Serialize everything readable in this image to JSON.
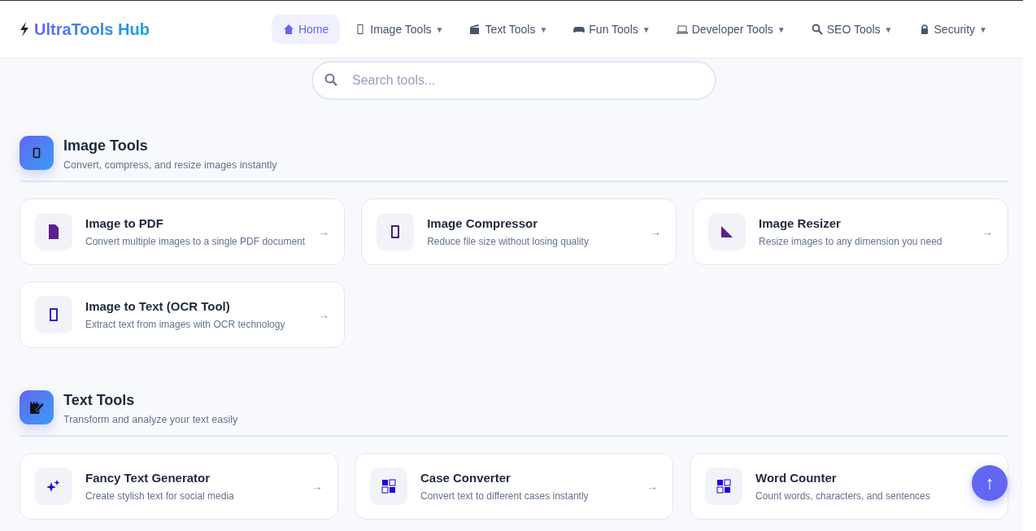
{
  "brand": {
    "name": "UltraTools Hub"
  },
  "nav": [
    {
      "label": "Home",
      "selected": true
    },
    {
      "label": "Image Tools",
      "caret": "▼",
      "selected": false
    },
    {
      "label": "Text Tools",
      "caret": "▼",
      "selected": false
    },
    {
      "label": "Fun Tools",
      "caret": "▼",
      "selected": false
    },
    {
      "label": "Developer Tools",
      "caret": "▼",
      "selected": false
    },
    {
      "label": "SEO Tools",
      "caret": "▼",
      "selected": false
    },
    {
      "label": "Security",
      "caret": "▼",
      "selected": false
    }
  ],
  "search": {
    "placeholder": "Search tools..."
  },
  "sections": [
    {
      "title": "Image Tools",
      "subtitle": "Convert, compress, and resize images instantly",
      "tools": [
        {
          "name": "Image to PDF",
          "description": "Convert multiple images to a single PDF document",
          "arrow": "→"
        },
        {
          "name": "Image Compressor",
          "description": "Reduce file size without losing quality",
          "arrow": "→"
        },
        {
          "name": "Image Resizer",
          "description": "Resize images to any dimension you need",
          "arrow": "→"
        },
        {
          "name": "Image to Text (OCR Tool)",
          "description": "Extract text from images with OCR technology",
          "arrow": "→"
        }
      ]
    },
    {
      "title": "Text Tools",
      "subtitle": "Transform and analyze your text easily",
      "tools": [
        {
          "name": "Fancy Text Generator",
          "description": "Create stylish text for social media",
          "arrow": "→"
        },
        {
          "name": "Case Converter",
          "description": "Convert text to different cases instantly",
          "arrow": "→"
        },
        {
          "name": "Word Counter",
          "description": "Count words, characters, and sentences"
        }
      ]
    }
  ],
  "back_to_top": {
    "label": "↑"
  }
}
